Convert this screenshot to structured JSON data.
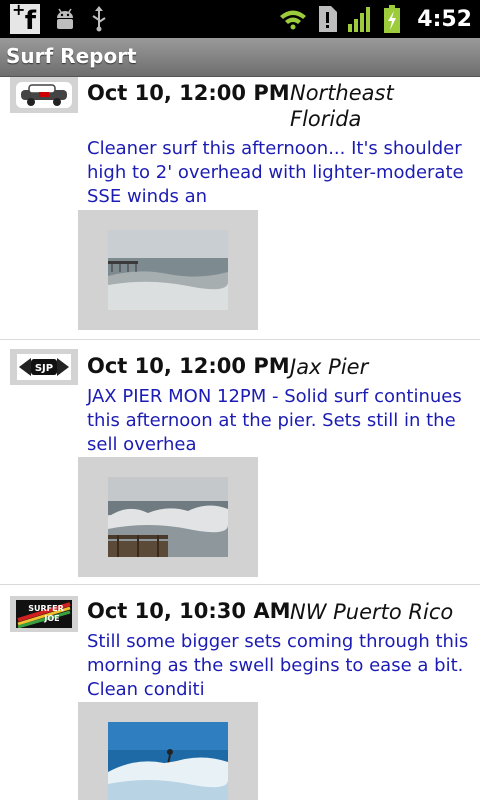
{
  "status_bar": {
    "time": "4:52",
    "icons": [
      "facebook-notification-icon",
      "android-debug-icon",
      "usb-icon",
      "wifi-icon",
      "alert-icon",
      "signal-icon",
      "battery-charging-icon"
    ]
  },
  "title_bar": {
    "title": "Surf Report"
  },
  "reports": [
    {
      "source_logo": "logo-1",
      "datetime": "Oct 10, 12:00 PM",
      "location": "Northeast Florida",
      "summary": "Cleaner surf this afternoon... It's shoulder high to 2' overhead with lighter-moderate SSE winds an"
    },
    {
      "source_logo": "SJP",
      "datetime": "Oct 10, 12:00 PM",
      "location": "Jax Pier",
      "summary": "JAX PIER MON 12PM - Solid surf continues this afternoon at the pier. Sets still in the sell overhea"
    },
    {
      "source_logo": "SURFER JOE",
      "datetime": "Oct 10, 10:30 AM",
      "location": "NW Puerto Rico",
      "summary": "Still some bigger sets coming through this morning as the swell begins to ease a bit. Clean conditi"
    }
  ],
  "colors": {
    "summary_text": "#1c1cb4",
    "title_bar": "#7d7d7d",
    "thumb_frame": "#d2d2d2"
  }
}
